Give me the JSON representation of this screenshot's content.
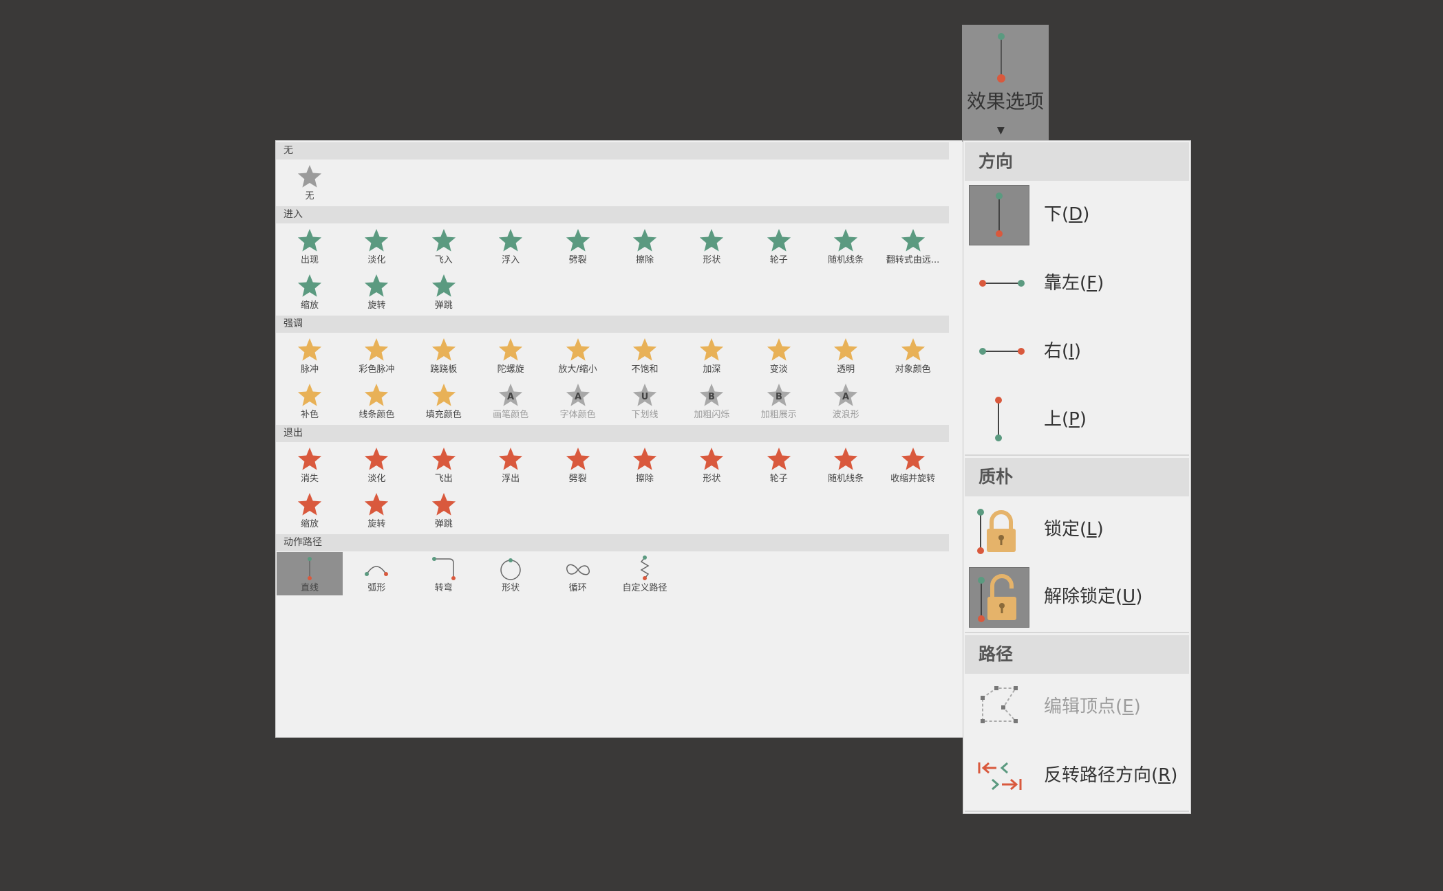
{
  "gallery": {
    "sections": [
      {
        "title": "无"
      },
      {
        "title": "进入"
      },
      {
        "title": "强调"
      },
      {
        "title": "退出"
      },
      {
        "title": "动作路径"
      }
    ],
    "none": [
      {
        "label": "无"
      }
    ],
    "entrance": [
      {
        "label": "出现"
      },
      {
        "label": "淡化"
      },
      {
        "label": "飞入"
      },
      {
        "label": "浮入"
      },
      {
        "label": "劈裂"
      },
      {
        "label": "擦除"
      },
      {
        "label": "形状"
      },
      {
        "label": "轮子"
      },
      {
        "label": "随机线条"
      },
      {
        "label": "翻转式由远..."
      },
      {
        "label": "缩放"
      },
      {
        "label": "旋转"
      },
      {
        "label": "弹跳"
      }
    ],
    "emphasis": [
      {
        "label": "脉冲"
      },
      {
        "label": "彩色脉冲"
      },
      {
        "label": "跷跷板"
      },
      {
        "label": "陀螺旋"
      },
      {
        "label": "放大/缩小"
      },
      {
        "label": "不饱和"
      },
      {
        "label": "加深"
      },
      {
        "label": "变淡"
      },
      {
        "label": "透明"
      },
      {
        "label": "对象颜色"
      },
      {
        "label": "补色"
      },
      {
        "label": "线条颜色"
      },
      {
        "label": "填充颜色"
      },
      {
        "label": "画笔颜色"
      },
      {
        "label": "字体颜色"
      },
      {
        "label": "下划线"
      },
      {
        "label": "加粗闪烁"
      },
      {
        "label": "加粗展示"
      },
      {
        "label": "波浪形"
      }
    ],
    "emphasis_glyphs": {
      "brush": "A",
      "font": "A",
      "underline": "U",
      "boldflash": "B",
      "boldshow": "B",
      "wave": "A"
    },
    "exit": [
      {
        "label": "消失"
      },
      {
        "label": "淡化"
      },
      {
        "label": "飞出"
      },
      {
        "label": "浮出"
      },
      {
        "label": "劈裂"
      },
      {
        "label": "擦除"
      },
      {
        "label": "形状"
      },
      {
        "label": "轮子"
      },
      {
        "label": "随机线条"
      },
      {
        "label": "收缩并旋转"
      },
      {
        "label": "缩放"
      },
      {
        "label": "旋转"
      },
      {
        "label": "弹跳"
      }
    ],
    "paths": [
      {
        "label": "直线"
      },
      {
        "label": "弧形"
      },
      {
        "label": "转弯"
      },
      {
        "label": "形状"
      },
      {
        "label": "循环"
      },
      {
        "label": "自定义路径"
      }
    ],
    "colors": {
      "none": "#9b9b9b",
      "entrance": "#5b9a80",
      "emphasis": "#e8b157",
      "exit": "#d9593d",
      "disabled": "#a8a8a8",
      "selected_bg": "#8f8f8f"
    }
  },
  "effect_options": {
    "label": "效果选项"
  },
  "menu": {
    "direction": {
      "title": "方向",
      "items": [
        {
          "text": "下(",
          "key": "D",
          "close": ")"
        },
        {
          "text": "靠左(",
          "key": "F",
          "close": ")"
        },
        {
          "text": "右(",
          "key": "I",
          "close": ")"
        },
        {
          "text": "上(",
          "key": "P",
          "close": ")"
        }
      ]
    },
    "sequence": {
      "title": "质朴",
      "items": [
        {
          "text": "锁定(",
          "key": "L",
          "close": ")"
        },
        {
          "text": "解除锁定(",
          "key": "U",
          "close": ")"
        }
      ]
    },
    "path": {
      "title": "路径",
      "items": [
        {
          "text": "编辑顶点(",
          "key": "E",
          "close": ")"
        },
        {
          "text": "反转路径方向(",
          "key": "R",
          "close": ")"
        }
      ]
    },
    "colors": {
      "green": "#5b9a80",
      "red": "#d9593d",
      "lock": "#e5b36a",
      "gray": "#888888"
    }
  }
}
